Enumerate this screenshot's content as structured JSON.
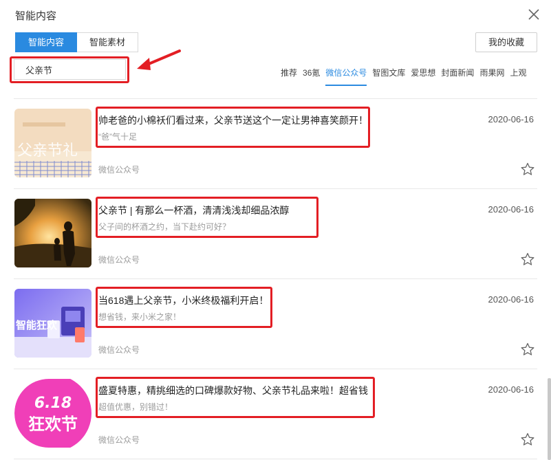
{
  "dialog": {
    "title": "智能内容"
  },
  "tabs": [
    {
      "label": "智能内容",
      "active": true
    },
    {
      "label": "智能素材",
      "active": false
    }
  ],
  "favorites_label": "我的收藏",
  "search": {
    "value": "父亲节"
  },
  "source_tabs": [
    {
      "label": "推荐"
    },
    {
      "label": "36氪"
    },
    {
      "label": "微信公众号",
      "active": true
    },
    {
      "label": "智图文库"
    },
    {
      "label": "爱思想"
    },
    {
      "label": "封面新闻"
    },
    {
      "label": "雨果网"
    },
    {
      "label": "上观"
    }
  ],
  "items": [
    {
      "title": "帅老爸的小棉袄们看过来，父亲节送这个一定让男神喜笑颜开！",
      "summary": "“爸”气十足",
      "source": "微信公众号",
      "date": "2020-06-16",
      "thumb_text": "父亲节礼"
    },
    {
      "title": "父亲节 | 有那么一杯酒，清清浅浅却细品浓醇",
      "summary": "父子间的杯酒之约，当下赴约可好？",
      "source": "微信公众号",
      "date": "2020-06-16"
    },
    {
      "title": "当618遇上父亲节，小米终极福利开启！",
      "summary": "想省钱，来小米之家！",
      "source": "微信公众号",
      "date": "2020-06-16",
      "thumb_text": "智能狂欢"
    },
    {
      "title": "盛夏特惠，精挑细选的口碑爆款好物、父亲节礼品来啦！超省钱",
      "summary": "超值优惠，别错过！",
      "source": "微信公众号",
      "date": "2020-06-16",
      "thumb_text_1": "6.18",
      "thumb_text_2": "狂欢节"
    }
  ],
  "colors": {
    "accent": "#2a8ae0",
    "highlight_red": "#e31e24"
  }
}
